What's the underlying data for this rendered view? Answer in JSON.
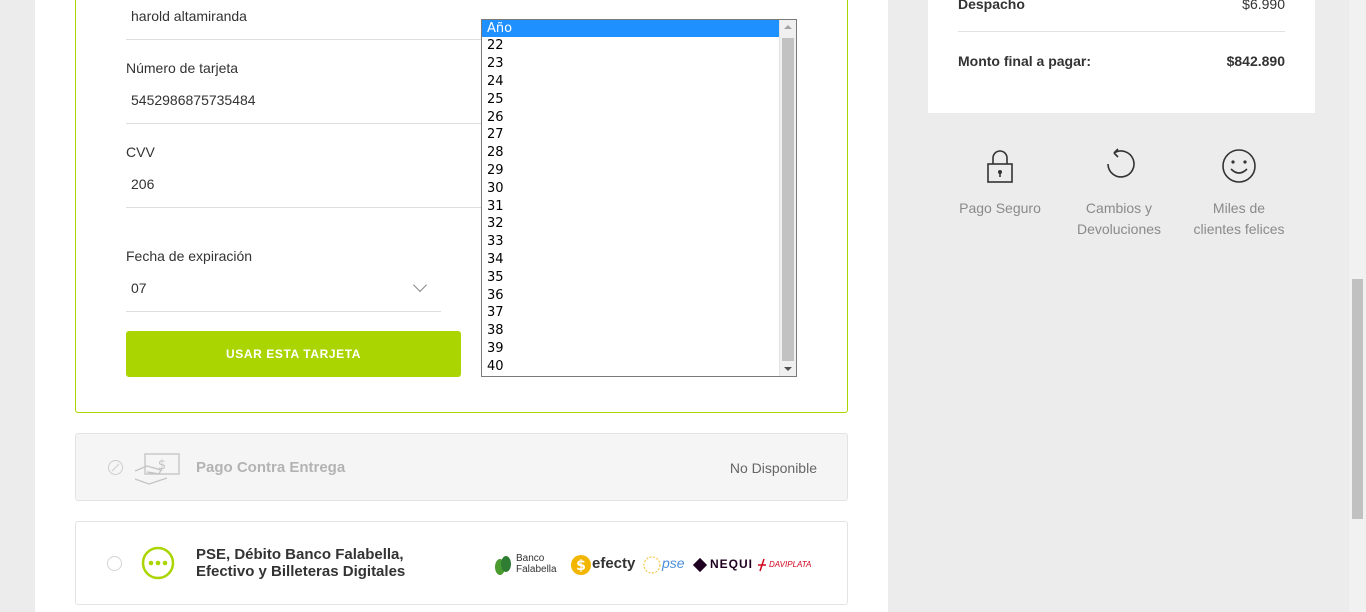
{
  "form": {
    "name_value": "harold altamiranda",
    "card_label": "Número de tarjeta",
    "card_value": "5452986875735484",
    "cvv_label": "CVV",
    "cvv_value": "206",
    "expiry_label": "Fecha de expiración",
    "month_value": "07",
    "submit_label": "USAR ESTA TARJETA"
  },
  "year_dropdown": {
    "options": [
      "Año",
      "22",
      "23",
      "24",
      "25",
      "26",
      "27",
      "28",
      "29",
      "30",
      "31",
      "32",
      "33",
      "34",
      "35",
      "36",
      "37",
      "38",
      "39",
      "40"
    ],
    "selected_index": 0
  },
  "payment_methods": {
    "cod": {
      "title": "Pago Contra Entrega",
      "status": "No Disponible"
    },
    "pse": {
      "title_line1": "PSE, Débito Banco Falabella,",
      "title_line2": "Efectivo y Billeteras Digitales",
      "logos": {
        "falabella_top": "Banco",
        "falabella_bottom": "Falabella",
        "efecty": "efecty",
        "pse": "pse",
        "nequi": "NEQUI",
        "daviplata": "DAVIPLATA"
      }
    }
  },
  "summary": {
    "shipping_label": "Despacho",
    "shipping_value": "$6.990",
    "total_label": "Monto final a pagar:",
    "total_value": "$842.890"
  },
  "benefits": {
    "secure": {
      "line1": "Pago Seguro",
      "line2": ""
    },
    "returns": {
      "line1": "Cambios y",
      "line2": "Devoluciones"
    },
    "happy": {
      "line1": "Miles de",
      "line2": "clientes felices"
    }
  },
  "colors": {
    "accent": "#aad500",
    "selected_option": "#1e90ff"
  }
}
